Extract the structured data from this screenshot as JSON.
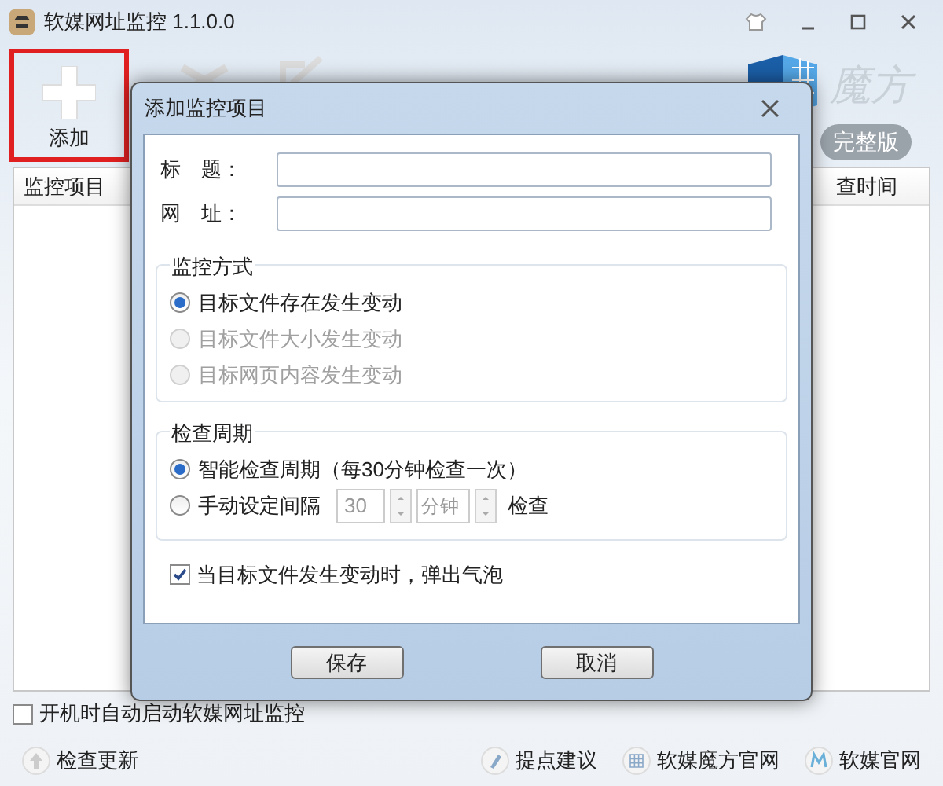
{
  "window": {
    "title": "软媒网址监控 1.1.0.0"
  },
  "toolbar": [
    {
      "label": "添加",
      "selected": true
    }
  ],
  "logo": {
    "text": "魔方",
    "badge": "完整版"
  },
  "table": {
    "columns": [
      "监控项目",
      "查时间"
    ]
  },
  "startup": {
    "label": "开机时自动启动软媒网址监控",
    "checked": false
  },
  "footer": {
    "left": "检查更新",
    "links": [
      {
        "kind": "pen",
        "label": "提点建议"
      },
      {
        "kind": "grid",
        "label": "软媒魔方官网"
      },
      {
        "kind": "m",
        "label": "软媒官网"
      }
    ]
  },
  "dialog": {
    "title": "添加监控项目",
    "fields": [
      {
        "label": "标　题："
      },
      {
        "label": "网　址："
      }
    ],
    "monitor_mode": {
      "title": "监控方式",
      "options": [
        {
          "label": "目标文件存在发生变动",
          "selected": true,
          "disabled": false
        },
        {
          "label": "目标文件大小发生变动",
          "selected": false,
          "disabled": true
        },
        {
          "label": "目标网页内容发生变动",
          "selected": false,
          "disabled": true
        }
      ]
    },
    "check_period": {
      "title": "检查周期",
      "options": [
        {
          "kind": "auto",
          "label": "智能检查周期（每30分钟检查一次）",
          "selected": true
        },
        {
          "kind": "manual",
          "label": "手动设定间隔",
          "selected": false,
          "interval": "30",
          "unit": "分钟",
          "suffix": "检查"
        }
      ]
    },
    "bubble": {
      "label": "当目标文件发生变动时，弹出气泡",
      "checked": true
    },
    "buttons": [
      "保存",
      "取消"
    ]
  }
}
